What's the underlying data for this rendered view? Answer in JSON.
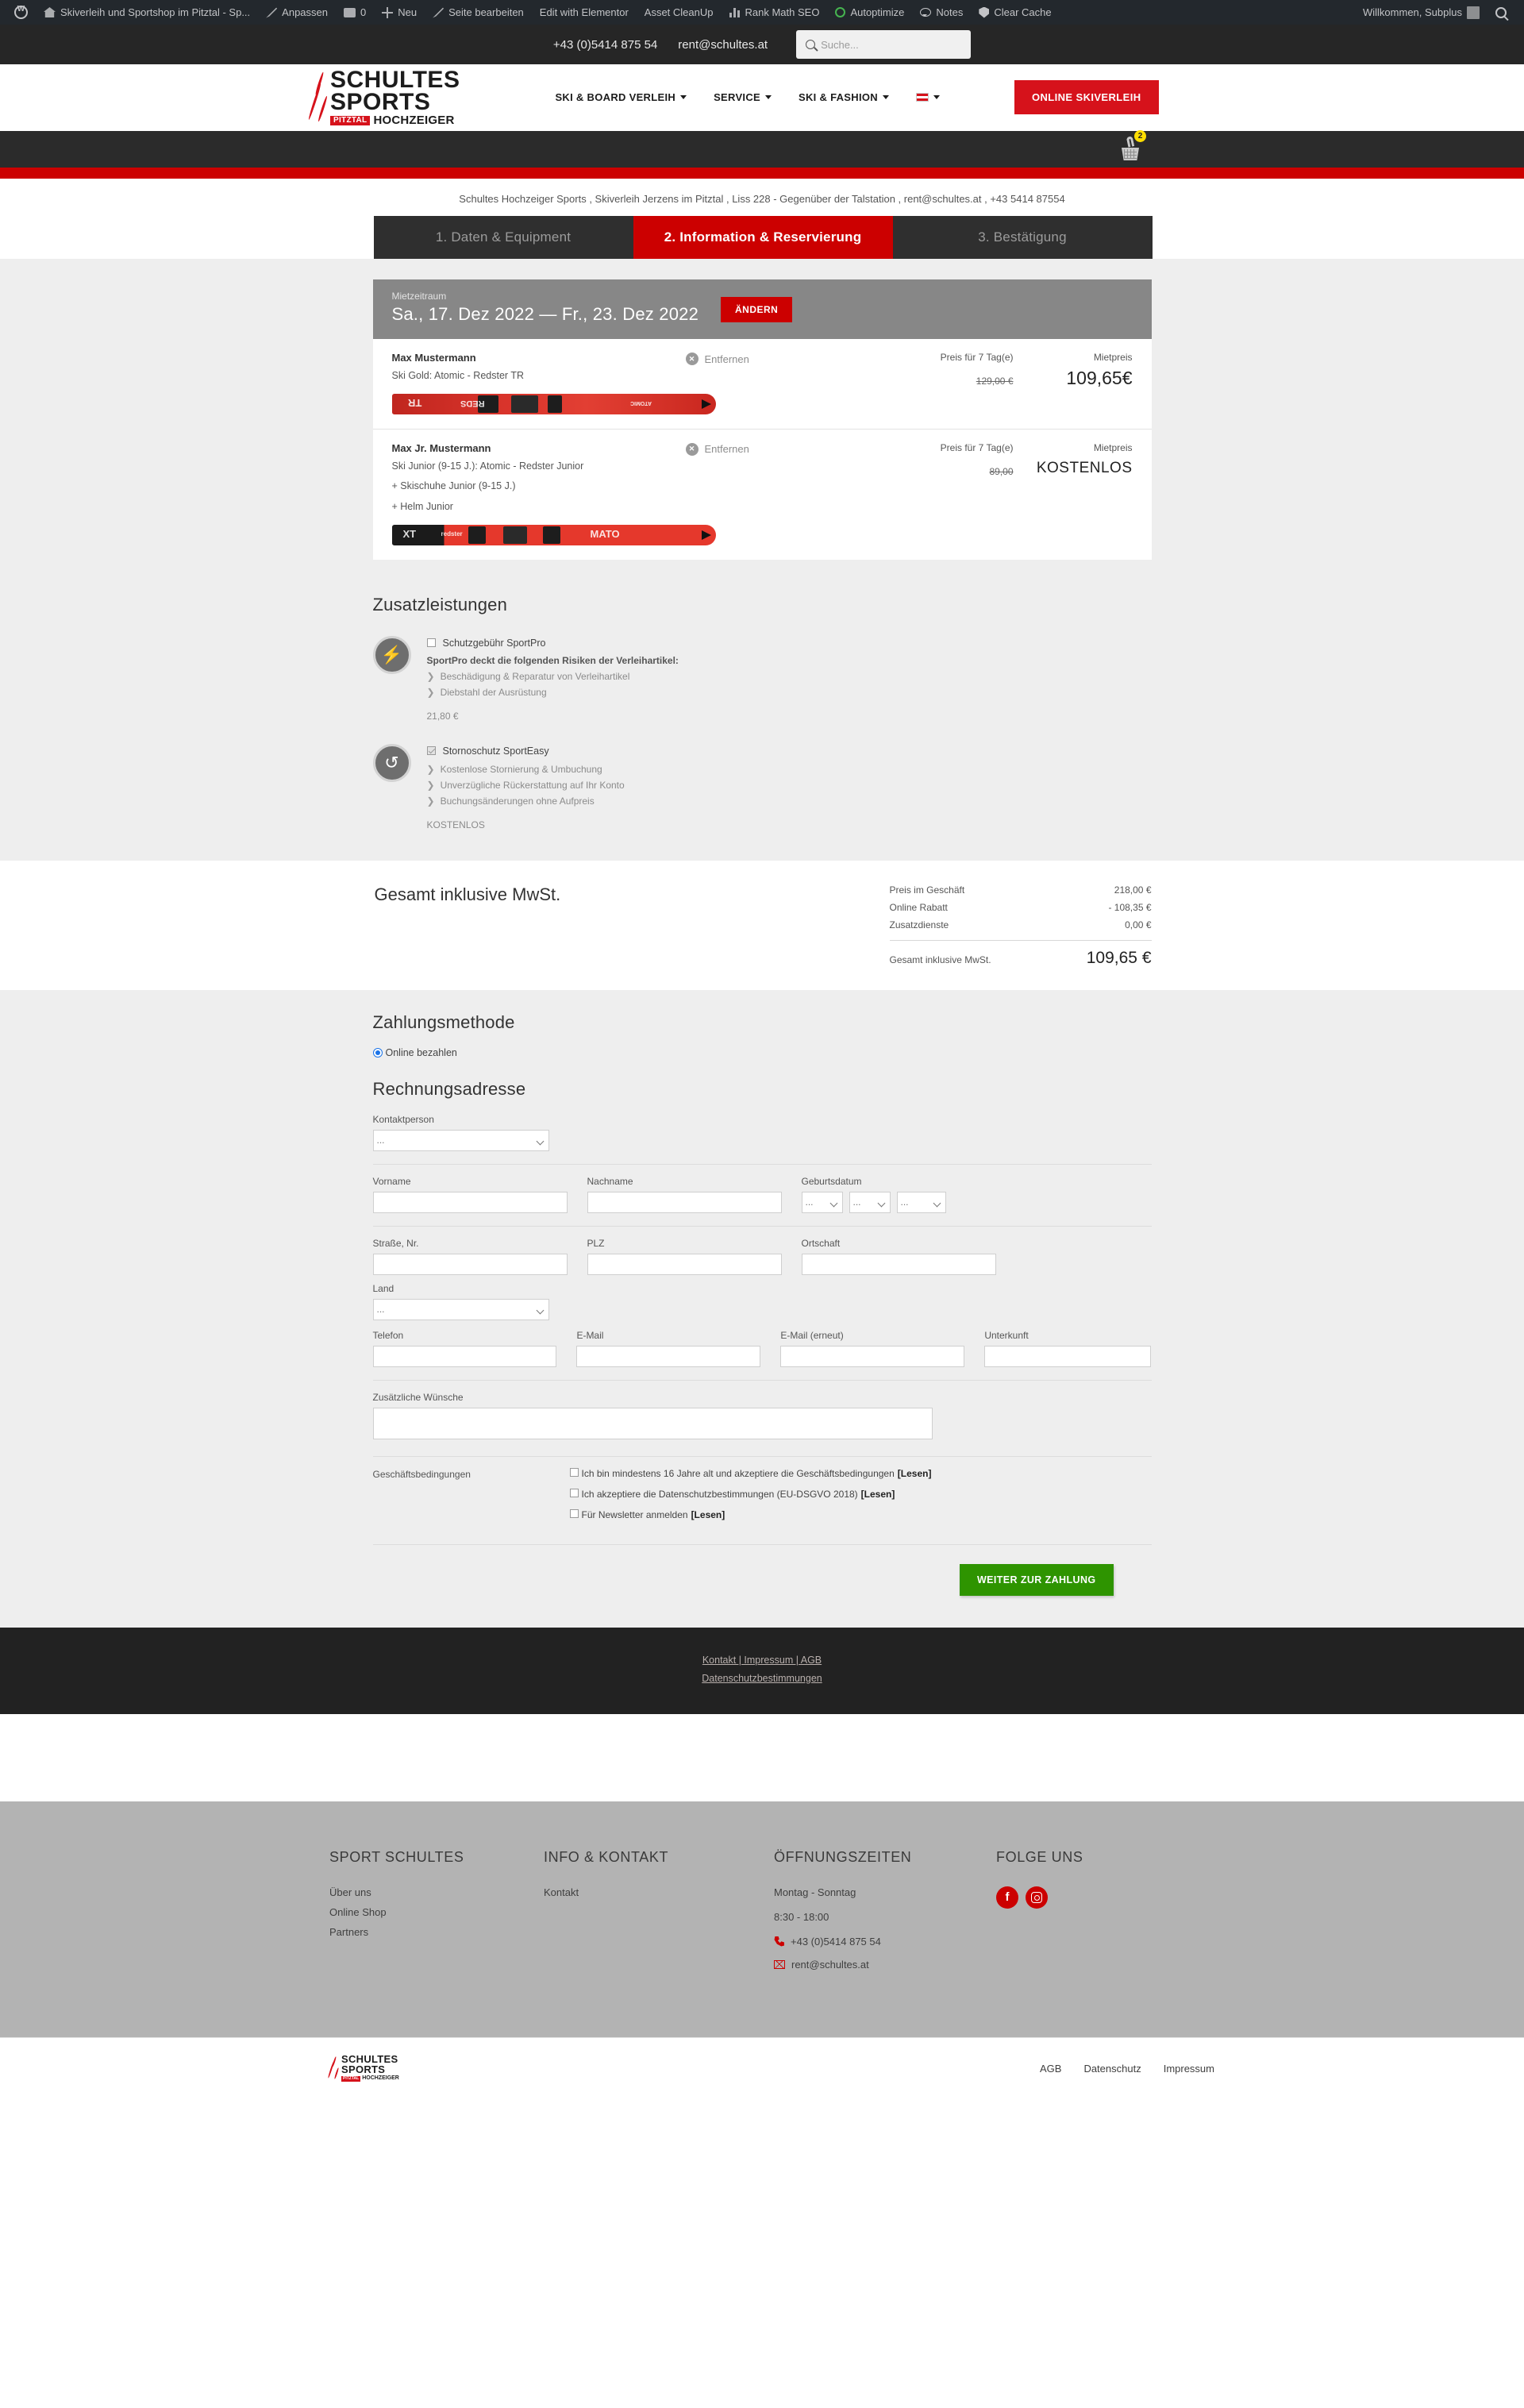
{
  "adminbar": {
    "items": [
      {
        "label": "",
        "icon": "wordpress-logo-icon"
      },
      {
        "label": "Skiverleih und Sportshop im Pitztal - Sp...",
        "icon": "site-home-icon"
      },
      {
        "label": "Anpassen",
        "icon": "pencil-icon"
      },
      {
        "label": "0",
        "icon": "comment-icon"
      },
      {
        "label": "Neu",
        "icon": "plus-icon"
      },
      {
        "label": "Seite bearbeiten",
        "icon": "pencil-icon"
      },
      {
        "label": "Edit with Elementor",
        "icon": ""
      },
      {
        "label": "Asset CleanUp",
        "icon": ""
      },
      {
        "label": "Rank Math SEO",
        "icon": "bars-icon"
      },
      {
        "label": "Autoptimize",
        "icon": "circle-o-icon"
      },
      {
        "label": "Notes",
        "icon": "chat-icon"
      },
      {
        "label": "Clear Cache",
        "icon": "shield-icon"
      }
    ],
    "greeting": "Willkommen, Subplus"
  },
  "topbar": {
    "phone": "+43 (0)5414 875 54",
    "email": "rent@schultes.at",
    "search_placeholder": "Suche...",
    "search_value": ""
  },
  "header": {
    "logo_line1": "SCHULTES",
    "logo_line2": "SPORTS",
    "logo_badge": "PITZTAL",
    "logo_sub": "HOCHZEIGER",
    "nav": [
      {
        "label": "SKI & BOARD VERLEIH",
        "has_caret": true
      },
      {
        "label": "SERVICE",
        "has_caret": true
      },
      {
        "label": "SKI & FASHION",
        "has_caret": true
      }
    ],
    "lang_flag": "austria-flag-icon",
    "cta": "ONLINE SKIVERLEIH",
    "cart_badge": "2"
  },
  "infoline": "Schultes Hochzeiger Sports , Skiverleih Jerzens im Pitztal , Liss 228 - Gegenüber der Talstation , rent@schultes.at , +43 5414 87554",
  "steps": [
    {
      "label": "1. Daten & Equipment",
      "active": false
    },
    {
      "label": "2. Information & Reservierung",
      "active": true
    },
    {
      "label": "3. Bestätigung",
      "active": false
    }
  ],
  "period": {
    "label": "Mietzeitraum",
    "dates": "Sa., 17. Dez 2022  —  Fr., 23. Dez 2022",
    "change_button": "ÄNDERN"
  },
  "cart_items": [
    {
      "name": "Max Mustermann",
      "desc": "Ski Gold: Atomic - Redster TR",
      "desc2": "",
      "desc3": "",
      "remove_label": "Entfernen",
      "price_header": "Preis für 7 Tag(e)",
      "rent_header": "Mietpreis",
      "old_price": "129,00 €",
      "price": "109,65€"
    },
    {
      "name": "Max Jr. Mustermann",
      "desc": "Ski Junior (9-15 J.): Atomic - Redster Junior",
      "desc2": "+ Skischuhe Junior (9-15 J.)",
      "desc3": "+ Helm Junior",
      "remove_label": "Entfernen",
      "price_header": "Preis für 7 Tag(e)",
      "rent_header": "Mietpreis",
      "old_price": "89,00",
      "price": "KOSTENLOS"
    }
  ],
  "addons": {
    "title": "Zusatzleistungen",
    "items": [
      {
        "icon": "damage-protection-icon",
        "name": "Schutzgebühr SportPro",
        "checked": false,
        "strong": "SportPro deckt die folgenden Risiken der Verleihartikel:",
        "bullets": [
          "Beschädigung & Reparatur von Verleihartikel",
          "Diebstahl der Ausrüstung"
        ],
        "price": "21,80 €"
      },
      {
        "icon": "cancellation-protection-icon",
        "name": "Stornoschutz SportEasy",
        "checked": true,
        "strong": "",
        "bullets": [
          "Kostenlose Stornierung & Umbuchung",
          "Unverzügliche Rückerstattung auf Ihr Konto",
          "Buchungsänderungen ohne Aufpreis"
        ],
        "price": "KOSTENLOS"
      }
    ]
  },
  "totals": {
    "title": "Gesamt inklusive MwSt.",
    "rows": [
      {
        "label": "Preis im Geschäft",
        "value": "218,00 €"
      },
      {
        "label": "Online Rabatt",
        "value": "- 108,35 €"
      },
      {
        "label": "Zusatzdienste",
        "value": "0,00 €"
      }
    ],
    "total_label": "Gesamt inklusive MwSt.",
    "total_value": "109,65 €"
  },
  "payment": {
    "title": "Zahlungsmethode",
    "option": "Online bezahlen"
  },
  "billing": {
    "title": "Rechnungsadresse",
    "contact_label": "Kontaktperson",
    "contact_value": "...",
    "vorname_label": "Vorname",
    "vorname_value": "",
    "nachname_label": "Nachname",
    "nachname_value": "",
    "geburtsdatum_label": "Geburtsdatum",
    "dob_day": "...",
    "dob_month": "...",
    "dob_year": "...",
    "strasse_label": "Straße, Nr.",
    "strasse_value": "",
    "plz_label": "PLZ",
    "plz_value": "",
    "ortschaft_label": "Ortschaft",
    "ortschaft_value": "",
    "land_label": "Land",
    "land_value": "...",
    "telefon_label": "Telefon",
    "telefon_value": "",
    "email_label": "E-Mail",
    "email_value": "",
    "email2_label": "E-Mail (erneut)",
    "email2_value": "",
    "unterkunft_label": "Unterkunft",
    "unterkunft_value": "",
    "wuensche_label": "Zusätzliche Wünsche",
    "wuensche_value": ""
  },
  "terms": {
    "label": "Geschäftsbedingungen",
    "items": [
      {
        "text": "Ich bin mindestens 16 Jahre alt und akzeptiere die Geschäftsbedingungen",
        "link": "[Lesen]"
      },
      {
        "text": "Ich akzeptiere die Datenschutzbestimmungen (EU-DSGVO 2018)",
        "link": "[Lesen]"
      },
      {
        "text": "Für Newsletter anmelden",
        "link": "[Lesen]"
      }
    ]
  },
  "submit": "WEITER ZUR ZAHLUNG",
  "darkfooter": {
    "line1": "Kontakt | Impressum | AGB",
    "line2": "Datenschutzbestimmungen"
  },
  "footer": {
    "col1": {
      "header": "SPORT SCHULTES",
      "links": [
        "Über uns",
        "Online Shop",
        "Partners"
      ]
    },
    "col2": {
      "header": "INFO & KONTAKT",
      "links": [
        "Kontakt"
      ]
    },
    "col3": {
      "header": "ÖFFNUNGSZEITEN",
      "days": "Montag - Sonntag",
      "hours": "8:30 - 18:00",
      "phone": "+43 (0)5414 875 54",
      "email": "rent@schultes.at"
    },
    "col4": {
      "header": "FOLGE UNS",
      "socials": [
        "facebook-icon",
        "instagram-icon"
      ]
    }
  },
  "bottombar": {
    "logo_line1": "SCHULTES",
    "logo_line2": "SPORTS",
    "logo_badge": "PITZTAL",
    "logo_sub": "HOCHZEIGER",
    "links": [
      "AGB",
      "Datenschutz",
      "Impressum"
    ]
  }
}
